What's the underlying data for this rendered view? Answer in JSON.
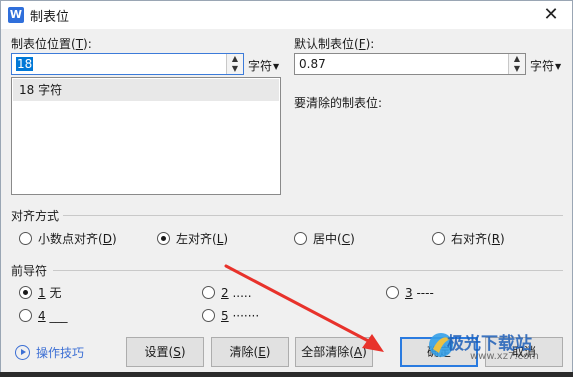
{
  "dialog": {
    "title": "制表位",
    "app_icon_letter": "W",
    "close_glyph": "✕"
  },
  "tab_position": {
    "label_main": "制表位位置(",
    "label_key": "T",
    "label_end": "):",
    "value": "18",
    "unit": "字符",
    "list_items": [
      "18 字符"
    ]
  },
  "default_tab": {
    "label_main": "默认制表位(",
    "label_key": "F",
    "label_end": "):",
    "value": "0.87",
    "unit": "字符"
  },
  "clear_label": "要清除的制表位:",
  "alignment": {
    "title": "对齐方式",
    "options": [
      {
        "text": "小数点对齐(",
        "key": "D",
        "end": ")",
        "selected": false
      },
      {
        "text": "左对齐(",
        "key": "L",
        "end": ")",
        "selected": true
      },
      {
        "text": "居中(",
        "key": "C",
        "end": ")",
        "selected": false
      },
      {
        "text": "右对齐(",
        "key": "R",
        "end": ")",
        "selected": false
      }
    ]
  },
  "leader": {
    "title": "前导符",
    "options": [
      {
        "key": "1",
        "text": " 无",
        "selected": true
      },
      {
        "key": "2",
        "text": " .....",
        "selected": false
      },
      {
        "key": "3",
        "text": " ----",
        "selected": false
      },
      {
        "key": "4",
        "text": " ___",
        "selected": false
      },
      {
        "key": "5",
        "text": " ·······",
        "selected": false
      }
    ]
  },
  "buttons": {
    "tips": "操作技巧",
    "set": {
      "text": "设置(",
      "key": "S",
      "end": ")"
    },
    "clear": {
      "text": "清除(",
      "key": "E",
      "end": ")"
    },
    "clear_all": {
      "text": "全部清除(",
      "key": "A",
      "end": ")"
    },
    "ok": "确定",
    "cancel": "取消"
  },
  "watermark": {
    "text": "极光下载站",
    "url": "www.xz7.com"
  },
  "colors": {
    "accent": "#0078d7",
    "arrow": "#e8322b",
    "default_button_border": "#2a7be0"
  }
}
